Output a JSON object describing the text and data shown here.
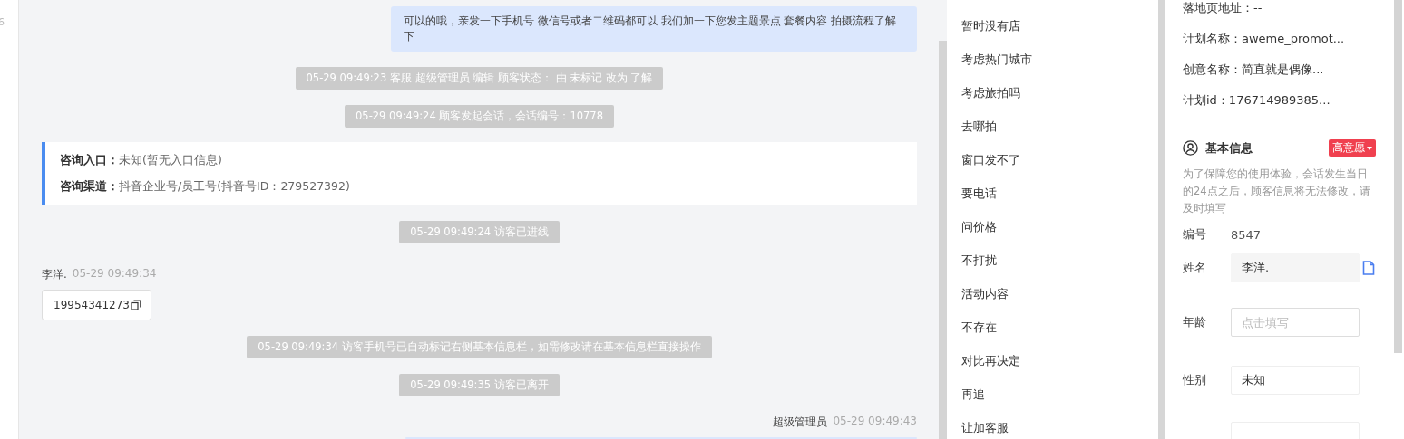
{
  "sidebar_fragment": {
    "text": "6"
  },
  "chat": {
    "messages": [
      {
        "kind": "agent_bubble",
        "text": "可以的哦，亲发一下手机号 微信号或者二维码都可以 我们加一下您发主题景点 套餐内容 拍摄流程了解下"
      },
      {
        "kind": "system",
        "text": "05-29 09:49:23 客服 超级管理员 编辑 顾客状态： 由 未标记 改为 了解"
      },
      {
        "kind": "system",
        "text": "05-29 09:49:24 顾客发起会话，会话编号：10778"
      },
      {
        "kind": "info_card",
        "rows": [
          {
            "label": "咨询入口：",
            "value": "未知(暂无入口信息)"
          },
          {
            "label": "咨询渠道：",
            "value": "抖音企业号/员工号(抖音号ID：279527392)"
          }
        ]
      },
      {
        "kind": "system",
        "text": "05-29 09:49:24 访客已进线"
      },
      {
        "kind": "customer",
        "name": "李洋.",
        "time": "05-29 09:49:34",
        "text": "19954341273"
      },
      {
        "kind": "system",
        "text": "05-29 09:49:34 访客手机号已自动标记右侧基本信息栏，如需修改请在基本信息栏直接操作"
      },
      {
        "kind": "system",
        "text": "05-29 09:49:35 访客已离开"
      },
      {
        "kind": "agent_header",
        "name": "超级管理员",
        "time": "05-29 09:49:43"
      },
      {
        "kind": "bubble_cut"
      }
    ]
  },
  "tags": [
    "暂时没有店",
    "考虑热门城市",
    "考虑旅拍吗",
    "去哪拍",
    "窗口发不了",
    "要电话",
    "问价格",
    "不打扰",
    "活动内容",
    "不存在",
    "对比再决定",
    "再追",
    "让加客服"
  ],
  "profile": {
    "ad_info": [
      "落地页地址：--",
      "计划名称：aweme_promot...",
      "创意名称：简直就是偶像...",
      "计划id：176714989385..."
    ],
    "section_title": "基本信息",
    "intent": "高意愿",
    "notice": "为了保障您的使用体验，会话发生当日的24点之后，顾客信息将无法修改，请及时填写",
    "fields": [
      {
        "kind": "plain",
        "label": "编号",
        "value": "8547"
      },
      {
        "kind": "filled",
        "label": "姓名",
        "value": "李洋."
      },
      {
        "kind": "empty",
        "label": "年龄",
        "placeholder": "点击填写"
      },
      {
        "kind": "select",
        "label": "性别",
        "value": "未知"
      },
      {
        "kind": "cut"
      }
    ]
  }
}
